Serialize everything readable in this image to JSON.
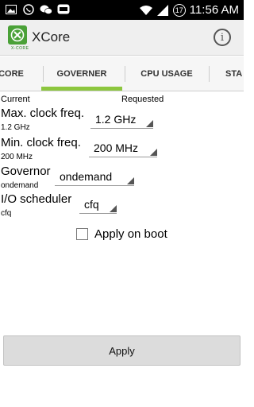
{
  "status_bar": {
    "time": "11:56 AM",
    "battery_level": "17",
    "icons": [
      "image-icon",
      "whatsapp-icon",
      "wechat-icon",
      "line-icon",
      "wifi-icon",
      "signal-icon",
      "battery-icon"
    ]
  },
  "action_bar": {
    "app_title": "XCore",
    "logo_subtitle": "X-CORE",
    "info_icon": "info-icon"
  },
  "tabs": [
    {
      "label": "CORE",
      "selected": false
    },
    {
      "label": "GOVERNER",
      "selected": true
    },
    {
      "label": "CPU USAGE",
      "selected": false
    },
    {
      "label": "STA",
      "selected": false
    }
  ],
  "colors": {
    "accent": "#8cc63e",
    "logo": "#4aa137"
  },
  "headers": {
    "current": "Current",
    "requested": "Requested"
  },
  "rows": {
    "max_freq": {
      "label": "Max. clock freq.",
      "current": "1.2 GHz",
      "requested": "1.2 GHz"
    },
    "min_freq": {
      "label": "Min. clock freq.",
      "current": "200 MHz",
      "requested": "200 MHz"
    },
    "governor": {
      "label": "Governor",
      "current": "ondemand",
      "requested": "ondemand"
    },
    "io_scheduler": {
      "label": "I/O scheduler",
      "current": "cfq",
      "requested": "cfq"
    }
  },
  "apply_on_boot": {
    "label": "Apply on boot",
    "checked": false
  },
  "apply_button": {
    "label": "Apply"
  }
}
